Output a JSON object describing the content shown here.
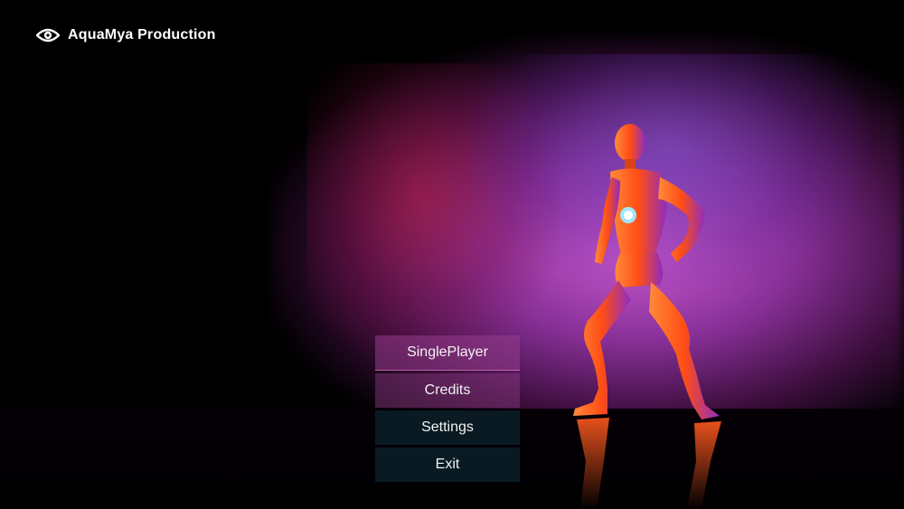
{
  "brand": {
    "name": "AquaMya Production",
    "icon": "eye-logo-icon"
  },
  "menu": {
    "items": [
      {
        "label": "SinglePlayer"
      },
      {
        "label": "Credits"
      },
      {
        "label": "Settings"
      },
      {
        "label": "Exit"
      }
    ]
  },
  "scene": {
    "subject": "orange-chrome-mannequin-figure",
    "colors": {
      "fog": "#c85ad4",
      "figure": "#ff5a1e",
      "background": "#000000",
      "button": "#0a1e28"
    }
  }
}
